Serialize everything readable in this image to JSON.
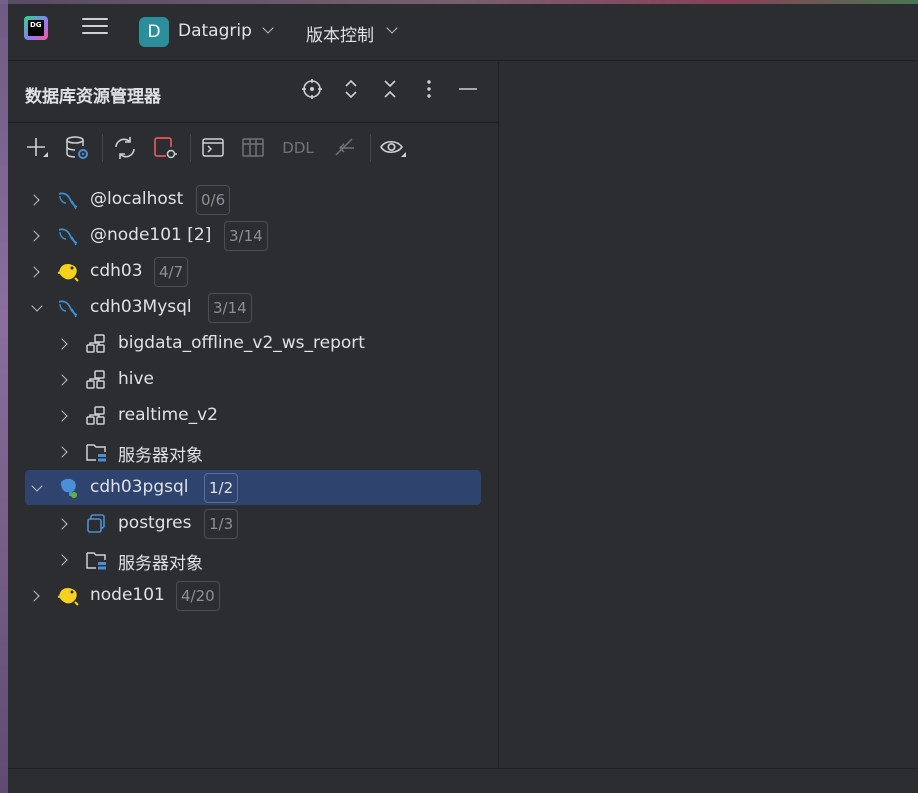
{
  "titlebar": {
    "project_badge": "D",
    "project_name": "Datagrip",
    "vcs_label": "版本控制",
    "logo_text": "DG",
    "icons": [
      "app-logo",
      "hamburger-menu-icon",
      "chevron-down-icon"
    ]
  },
  "panel": {
    "title": "数据库资源管理器",
    "header_icons": [
      "crosshair-icon",
      "expand-icon",
      "collapse-icon",
      "more-icon",
      "minimize-icon"
    ],
    "toolbar": {
      "icons": [
        "add-icon",
        "data-source-properties-icon",
        "refresh-icon",
        "disconnect-icon",
        "console-icon",
        "table-icon",
        "ddl",
        "jump-icon",
        "eye-icon"
      ],
      "ddl_label": "DDL"
    }
  },
  "tree": [
    {
      "label": "@localhost",
      "count": "0/6",
      "icon": "mysql-icon",
      "state": "collapsed",
      "level": 0
    },
    {
      "label": "@node101 [2]",
      "count": "3/14",
      "icon": "mysql-icon",
      "state": "collapsed",
      "level": 0
    },
    {
      "label": "cdh03",
      "count": "4/7",
      "icon": "hive-icon",
      "state": "collapsed",
      "level": 0
    },
    {
      "label": "cdh03Mysql",
      "count": "3/14",
      "icon": "mysql-icon",
      "state": "expanded",
      "level": 0
    },
    {
      "label": "bigdata_offline_v2_ws_report",
      "count": "",
      "icon": "schema-icon",
      "state": "collapsed",
      "level": 1
    },
    {
      "label": "hive",
      "count": "",
      "icon": "schema-icon",
      "state": "collapsed",
      "level": 1
    },
    {
      "label": "realtime_v2",
      "count": "",
      "icon": "schema-icon",
      "state": "collapsed",
      "level": 1
    },
    {
      "label": "服务器对象",
      "count": "",
      "icon": "server-objects-icon",
      "state": "collapsed",
      "level": 1
    },
    {
      "label": "cdh03pgsql",
      "count": "1/2",
      "icon": "postgresql-icon",
      "state": "expanded",
      "level": 0,
      "selected": true
    },
    {
      "label": "postgres",
      "count": "1/3",
      "icon": "database-icon",
      "state": "collapsed",
      "level": 1
    },
    {
      "label": "服务器对象",
      "count": "",
      "icon": "server-objects-icon",
      "state": "collapsed",
      "level": 1
    },
    {
      "label": "node101",
      "count": "4/20",
      "icon": "hive-icon",
      "state": "collapsed",
      "level": 0
    }
  ],
  "colors": {
    "background": "#2b2d30",
    "selection": "#2e436e",
    "mysql": "#3d8fd1",
    "hive": "#f5d21d",
    "postgres": "#4c8fd6",
    "connected": "#5fb832",
    "project_badge": "#2a8f9a"
  }
}
